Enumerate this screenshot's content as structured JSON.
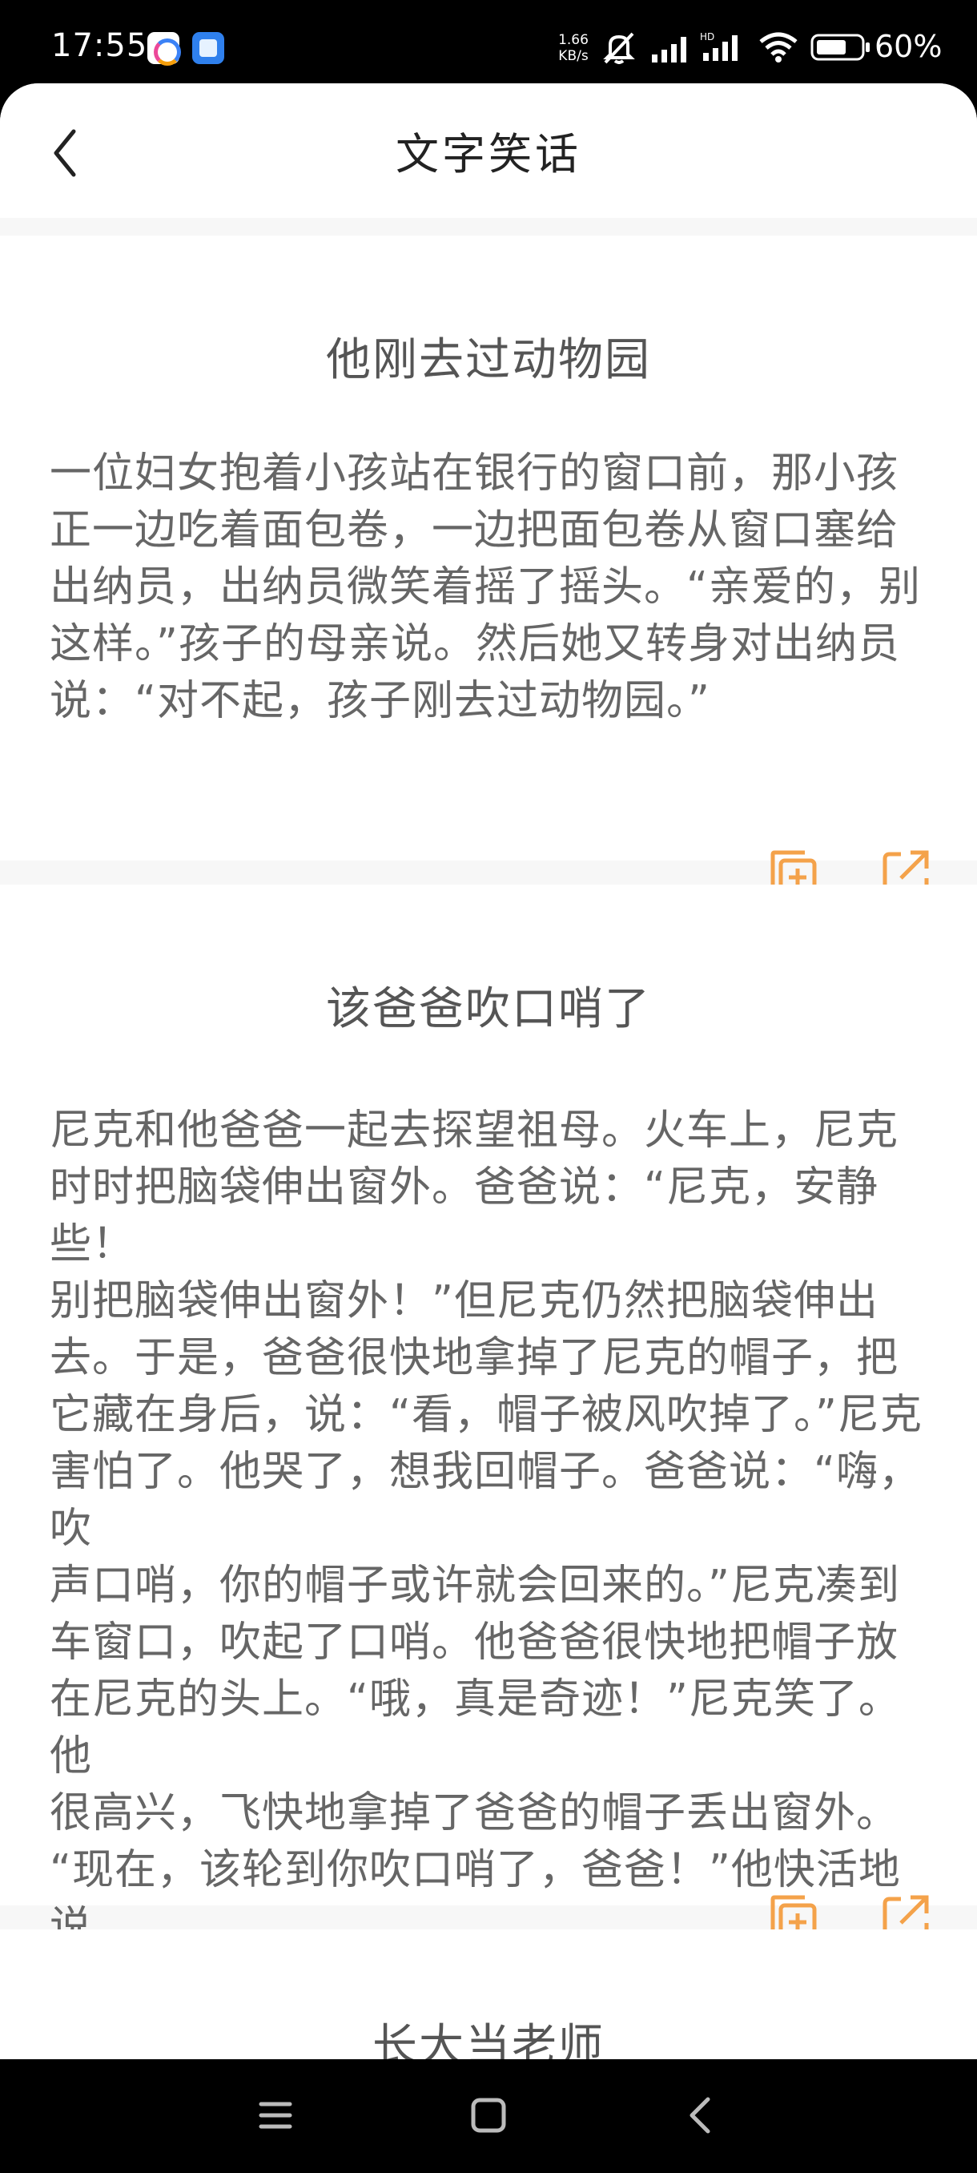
{
  "status_bar": {
    "time": "17:55",
    "net_speed_value": "1.66",
    "net_speed_unit": "KB/s",
    "battery_percent": "60%",
    "icons": [
      "app-icon-1",
      "app-icon-2",
      "mute-icon",
      "signal-icon",
      "hd-signal-icon",
      "wifi-icon",
      "battery-icon"
    ]
  },
  "header": {
    "title": "文字笑话",
    "back_icon": "chevron-left-icon"
  },
  "jokes": [
    {
      "title": "他刚去过动物园",
      "body": "一位妇女抱着小孩站在银行的窗口前，那小孩\n正一边吃着面包卷，一边把面包卷从窗口塞给\n出纳员，出纳员微笑着摇了摇头。“亲爱的，别\n这样。”孩子的母亲说。然后她又转身对出纳员\n说：“对不起，孩子刚去过动物园。”"
    },
    {
      "title": "该爸爸吹口哨了",
      "body": "尼克和他爸爸一起去探望祖母。火车上，尼克\n时时把脑袋伸出窗外。爸爸说：“尼克，安静些！\n别把脑袋伸出窗外！”但尼克仍然把脑袋伸出\n去。于是，爸爸很快地拿掉了尼克的帽子，把\n它藏在身后，说：“看，帽子被风吹掉了。”尼克\n害怕了。他哭了，想我回帽子。爸爸说：“嗨，吹\n声口哨，你的帽子或许就会回来的。”尼克凑到\n车窗口，吹起了口哨。他爸爸很快地把帽子放\n在尼克的头上。“哦，真是奇迹！”尼克笑了。他\n很高兴，飞快地拿掉了爸爸的帽子丢出窗外。\n“现在，该轮到你吹口哨了，爸爸！”他快活地\n说。"
    },
    {
      "title": "长大当老师"
    }
  ],
  "actions": {
    "copy_icon": "copy-add-icon",
    "share_icon": "share-icon",
    "accent_color": "#f4a24a"
  },
  "system_nav": {
    "icons": [
      "menu-icon",
      "home-icon",
      "back-icon"
    ]
  }
}
